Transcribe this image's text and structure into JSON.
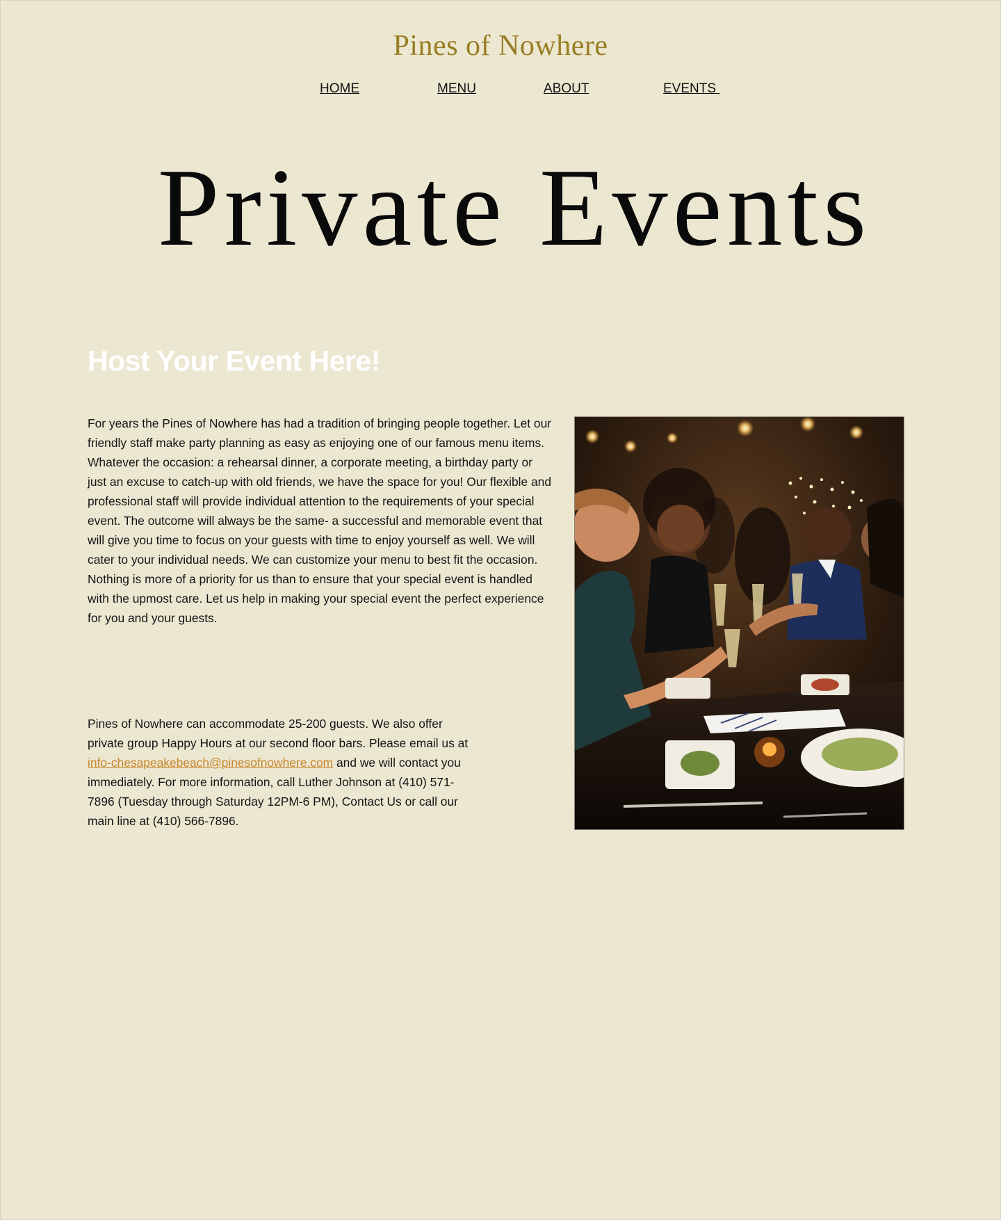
{
  "header": {
    "brand": "Pines of Nowhere",
    "nav": {
      "home": "HOME",
      "menu": "MENU",
      "about": "ABOUT",
      "events": "EVENTS "
    }
  },
  "hero": {
    "title": "Private Events"
  },
  "section": {
    "heading": "Host Your Event Here!",
    "paragraph_1": "For years the Pines of Nowhere has had a tradition of bringing people together. Let our friendly staff make party planning as easy as enjoying one of our famous menu items. Whatever the occasion: a rehearsal dinner, a corporate meeting, a birthday party or just an excuse to catch-up with old friends, we have the space for you! Our flexible and professional staff will provide individual attention to the requirements of your special event. The outcome will always be the same- a successful and memorable event that will give you time to focus on your guests with time to enjoy yourself as well. We will cater to your individual needs. We can customize your menu to best fit the occasion. Nothing is more of a priority for us than to ensure that your special event is handled with the upmost care. Let us help in making your special event the perfect experience for you and your guests.",
    "paragraph_2_before": "Pines of Nowhere can accommodate 25-200 guests. We also offer private group Happy Hours at our second floor bars. Please email us at ",
    "email": "info-chesapeakebeach@pinesofnowhere.com",
    "paragraph_2_after": " and we will contact you immediately. For more information, call Luther Johnson  at (410) 571-7896 (Tuesday through Saturday 12PM-6 PM), Contact Us or call our main line at (410) 566-7896."
  },
  "image": {
    "subject": "friends-toasting-at-dinner-photo"
  },
  "colors": {
    "background": "#ebe7d1",
    "brand": "#9a7d24",
    "heading": "#ffffff",
    "link": "#c8852a",
    "text": "#151515"
  }
}
